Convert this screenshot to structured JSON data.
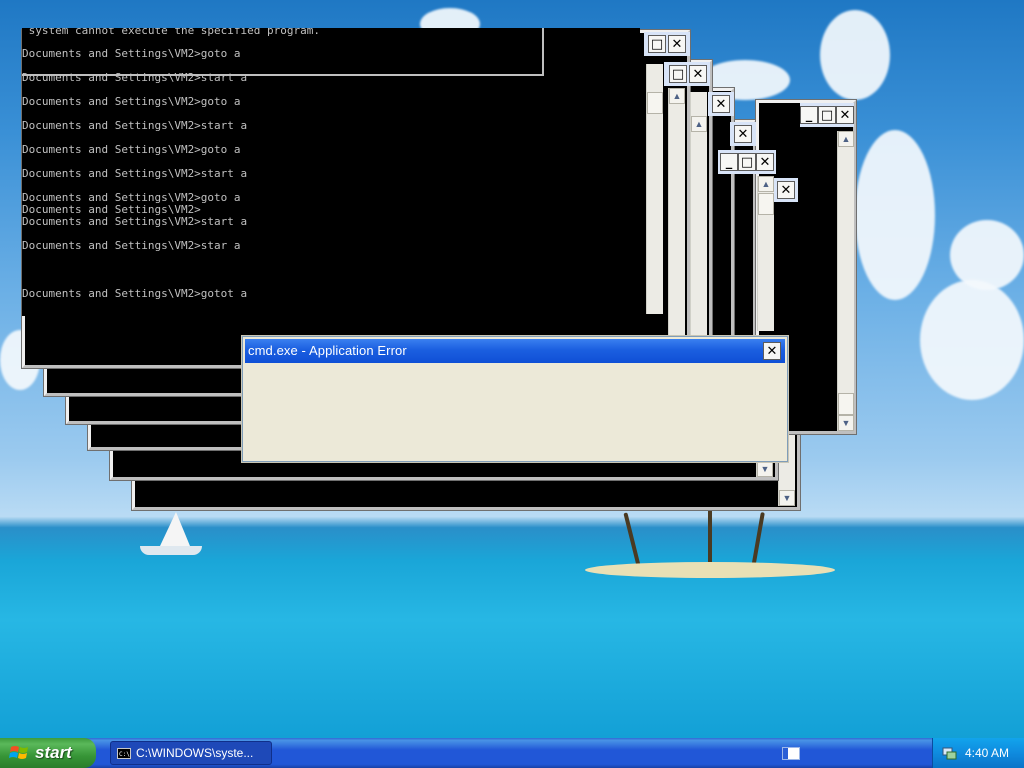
{
  "console": {
    "lines": [
      " system cannot execute the specified program.",
      "Documents and Settings\\VM2>goto a",
      "Documents and Settings\\VM2>start a",
      "Documents and Settings\\VM2>goto a",
      "Documents and Settings\\VM2>start a",
      "Documents and Settings\\VM2>goto a",
      "Documents and Settings\\VM2>start a",
      "Documents and Settings\\VM2>goto a",
      "Documents and Settings\\VM2>",
      "Documents and Settings\\VM2>start a",
      "Documents and Settings\\VM2>star a",
      "Documents and Settings\\VM2>gotot a"
    ]
  },
  "window_controls": {
    "minimize": "_",
    "maximize": "□",
    "close": "✕"
  },
  "scroll_arrows": {
    "up": "▲",
    "down": "▼"
  },
  "error_dialog": {
    "title": "cmd.exe - Application Error",
    "close": "✕"
  },
  "taskbar": {
    "start_label": "start",
    "task_label": "C:\\WINDOWS\\syste...",
    "clock": "4:40 AM"
  },
  "icons": {
    "start": "windows-flag-icon",
    "task": "command-prompt-icon",
    "tray": "network-icon"
  }
}
